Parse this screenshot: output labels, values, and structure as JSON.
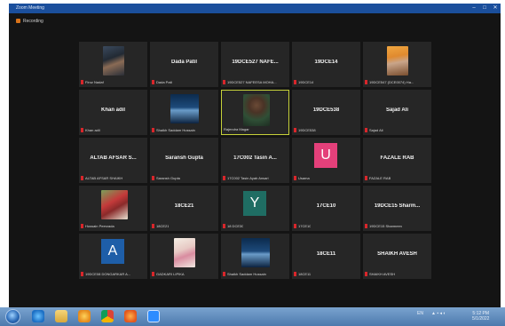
{
  "window": {
    "title": "Zoom Meeting"
  },
  "status": {
    "recording_label": "Recording"
  },
  "participants": [
    {
      "name": "Firoz Nadaf",
      "display": "",
      "type": "photo"
    },
    {
      "name": "Dada Patil",
      "display": "Dada Patil",
      "type": "name"
    },
    {
      "name": "19DCE527 NAFEESA MOHA...",
      "display": "19DCE527 NAFE...",
      "type": "name"
    },
    {
      "name": "19DCE14",
      "display": "19DCE14",
      "type": "name"
    },
    {
      "name": "19DCE547 (DCE0074) Ha...",
      "display": "",
      "type": "photo"
    },
    {
      "name": "Khan adil",
      "display": "Khan adil",
      "type": "name"
    },
    {
      "name": "Shaikh Saddam Hussain",
      "display": "",
      "type": "photo"
    },
    {
      "name": "Rajendra Magar",
      "display": "",
      "type": "photo"
    },
    {
      "name": "19DCE538",
      "display": "19DCE538",
      "type": "name"
    },
    {
      "name": "Sajad Ali",
      "display": "Sajad Ali",
      "type": "name"
    },
    {
      "name": "ALTAB AFSAR SHAIKH",
      "display": "ALTAB AFSAR S...",
      "type": "name"
    },
    {
      "name": "Saransh Gupta",
      "display": "Saransh Gupta",
      "type": "name"
    },
    {
      "name": "17C002 Tasin Ayab Ansari",
      "display": "17C002 Tasin A...",
      "type": "name"
    },
    {
      "name": "Usama",
      "display": "U",
      "type": "letter"
    },
    {
      "name": "FAZALE RAB",
      "display": "FAZALE RAB",
      "type": "name"
    },
    {
      "name": "Hussain Peerzada",
      "display": "",
      "type": "photo"
    },
    {
      "name": "18CE21",
      "display": "18CE21",
      "type": "name"
    },
    {
      "name": "18 DCE30",
      "display": "Y",
      "type": "letter"
    },
    {
      "name": "17CE10",
      "display": "17CE10",
      "type": "name"
    },
    {
      "name": "19DCE15 Sharmeen",
      "display": "19DCE15 Sharm...",
      "type": "name"
    },
    {
      "name": "19DCE08 DONGARKAR A...",
      "display": "A",
      "type": "letter"
    },
    {
      "name": "GADKARI LIPIKA",
      "display": "",
      "type": "photo"
    },
    {
      "name": "Shaikh Saddam Hussain",
      "display": "",
      "type": "photo"
    },
    {
      "name": "18CE11",
      "display": "18CE11",
      "type": "name"
    },
    {
      "name": "SHAIKH AVESH",
      "display": "SHAIKH AVESH",
      "type": "name"
    }
  ],
  "taskbar": {
    "tray_text": "EN",
    "time": "5:12 PM",
    "date": "5/1/2022"
  },
  "colors": {
    "titlebar": "#1b4f9c",
    "active_speaker_border": "#c6d13a",
    "mute_red": "#d8262b",
    "avatar_pink": "#e4407a",
    "avatar_teal": "#1f6d63",
    "avatar_blue": "#1e5ea8"
  }
}
